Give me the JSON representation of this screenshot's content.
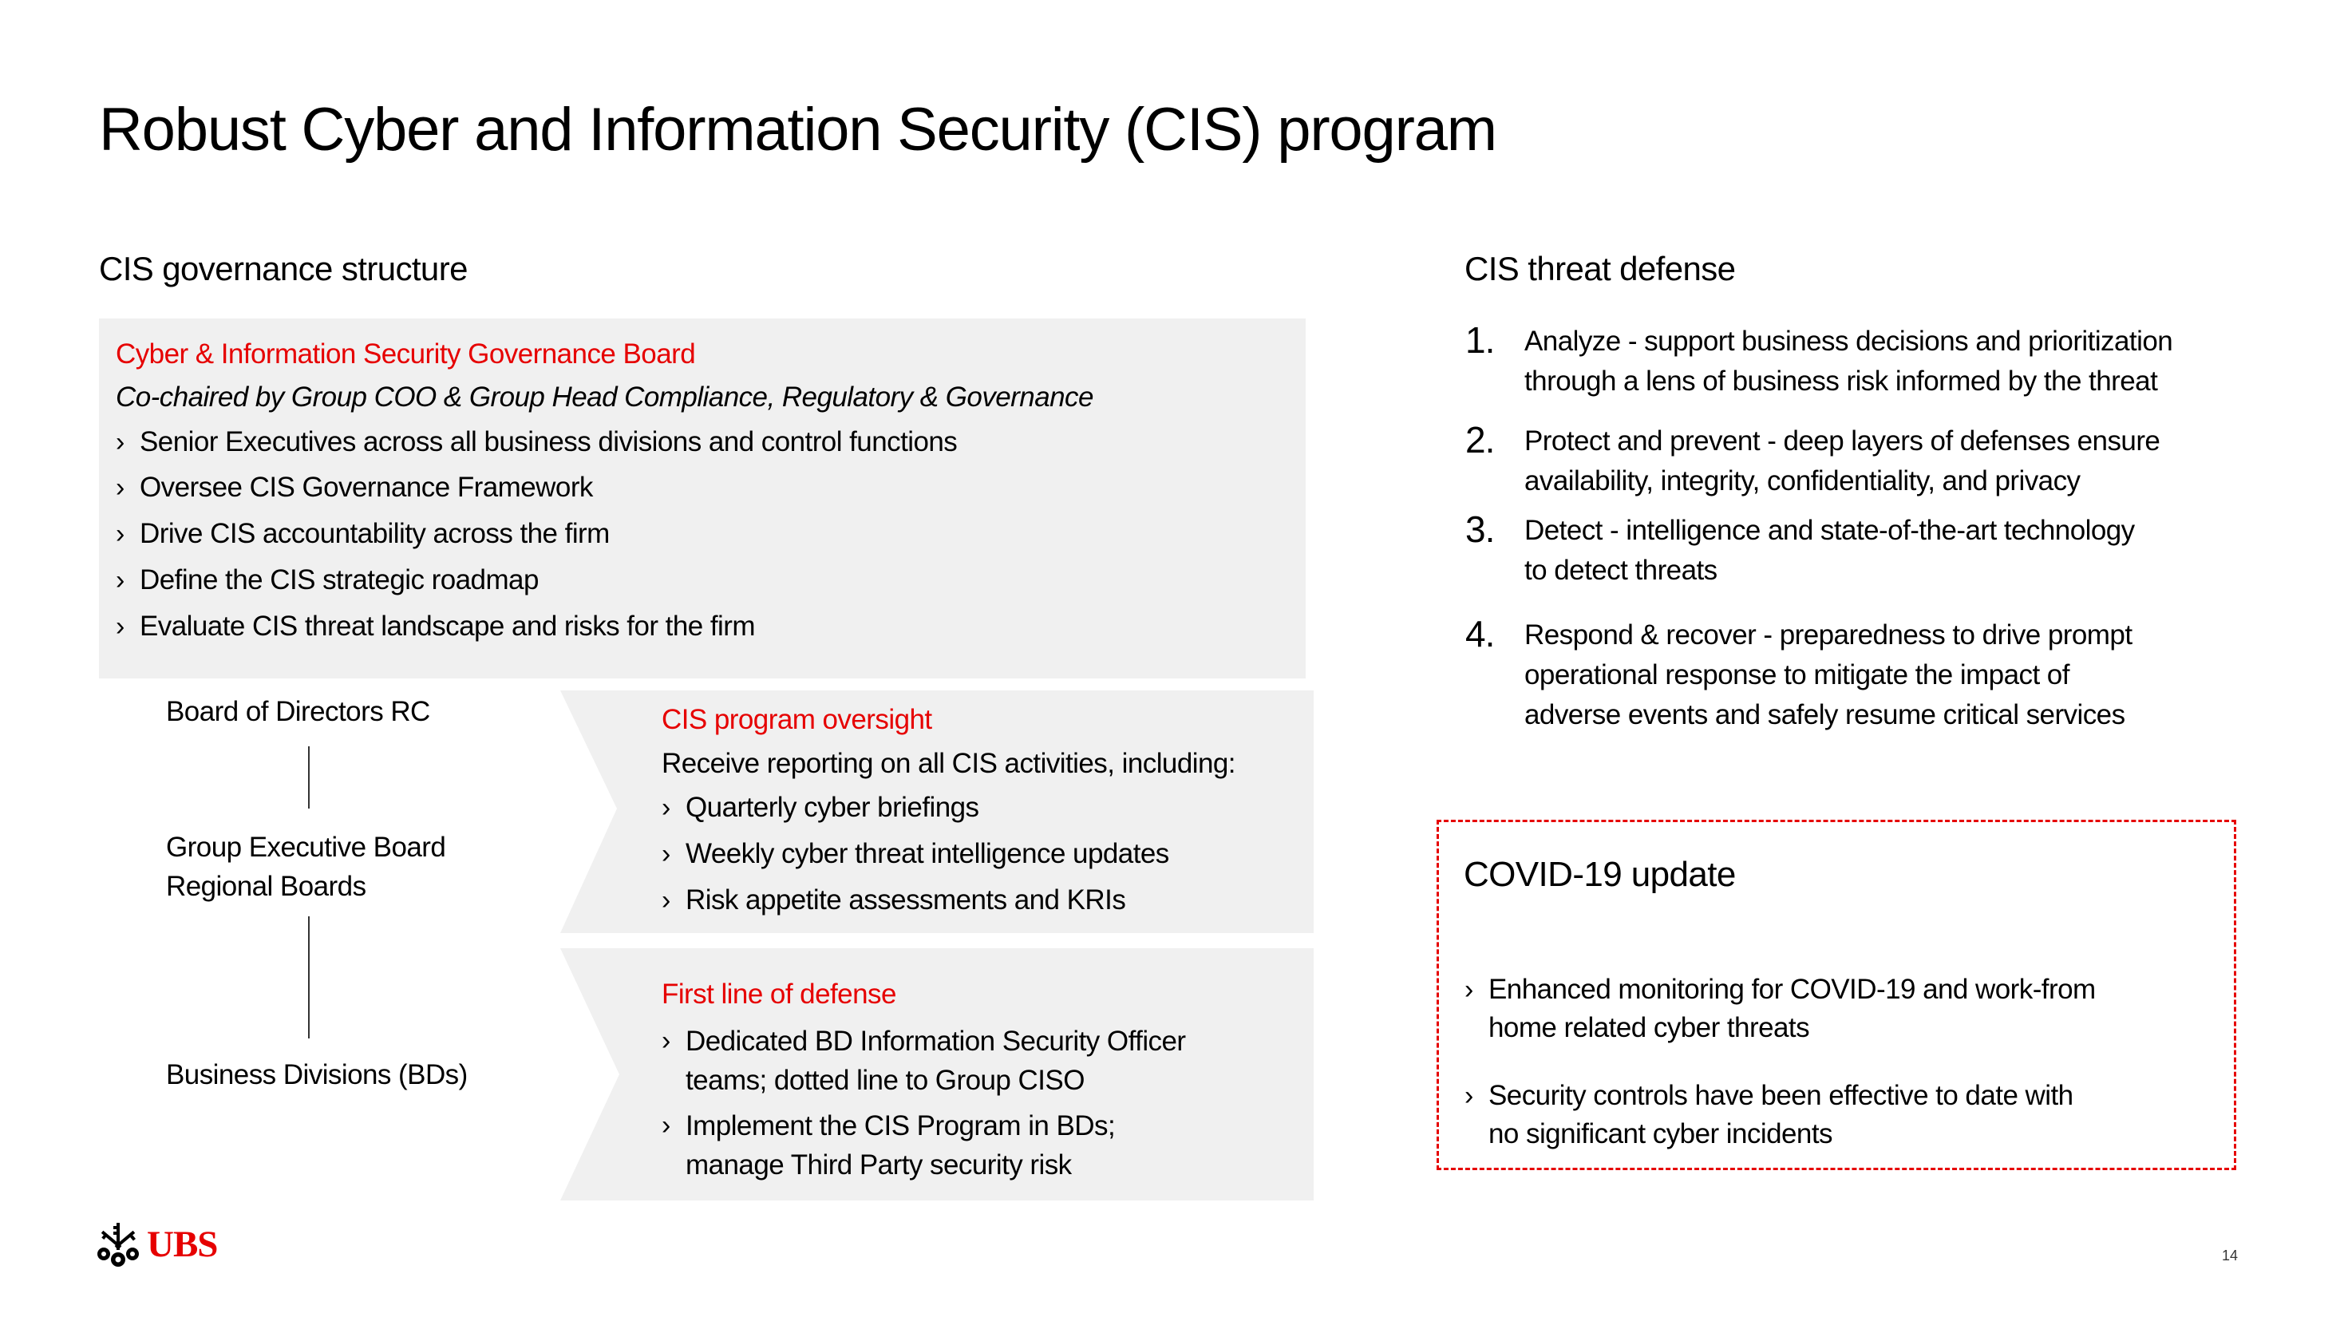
{
  "slide": {
    "title": "Robust Cyber and Information Security (CIS) program",
    "page_number": "14",
    "brand": {
      "name": "UBS",
      "accent_color": "#e60000"
    }
  },
  "governance": {
    "heading": "CIS governance structure",
    "board": {
      "title": "Cyber & Information Security Governance Board",
      "subtitle": "Co-chaired by Group COO & Group Head Compliance, Regulatory & Governance",
      "bullets": [
        "Senior Executives across all business divisions and control functions",
        "Oversee CIS Governance Framework",
        "Drive CIS accountability across the firm",
        "Define the CIS strategic roadmap",
        "Evaluate CIS threat landscape and risks for the firm"
      ]
    },
    "hierarchy": [
      {
        "lines": [
          "Board of Directors RC"
        ]
      },
      {
        "lines": [
          "Group Executive Board",
          "Regional Boards"
        ]
      },
      {
        "lines": [
          "Business Divisions (BDs)"
        ]
      }
    ],
    "oversight": {
      "title": "CIS program oversight",
      "intro": "Receive reporting on all CIS activities, including:",
      "bullets": [
        "Quarterly cyber briefings",
        "Weekly cyber threat intelligence updates",
        "Risk appetite assessments and KRIs"
      ]
    },
    "first_line": {
      "title": "First line of defense",
      "bullets": [
        [
          "Dedicated BD Information Security Officer",
          "teams; dotted line to Group CISO"
        ],
        [
          "Implement the CIS Program in BDs;",
          "manage Third Party security risk"
        ]
      ]
    }
  },
  "threat_defense": {
    "heading": "CIS threat defense",
    "items": [
      {
        "num": "1.",
        "lines": [
          "Analyze - support business decisions and prioritization",
          "through a lens of business risk informed by the threat"
        ]
      },
      {
        "num": "2.",
        "lines": [
          "Protect and prevent - deep layers of defenses ensure",
          "availability, integrity, confidentiality, and privacy"
        ]
      },
      {
        "num": "3.",
        "lines": [
          "Detect - intelligence and state-of-the-art technology",
          "to detect threats"
        ]
      },
      {
        "num": "4.",
        "lines": [
          "Respond & recover - preparedness to drive prompt",
          "operational response to mitigate the impact of",
          "adverse events and safely resume critical services"
        ]
      }
    ]
  },
  "covid": {
    "heading": "COVID-19 update",
    "bullets": [
      [
        "Enhanced monitoring for COVID-19 and work-from",
        "home related cyber threats"
      ],
      [
        "Security controls have been effective to date with",
        "no significant cyber incidents"
      ]
    ]
  }
}
